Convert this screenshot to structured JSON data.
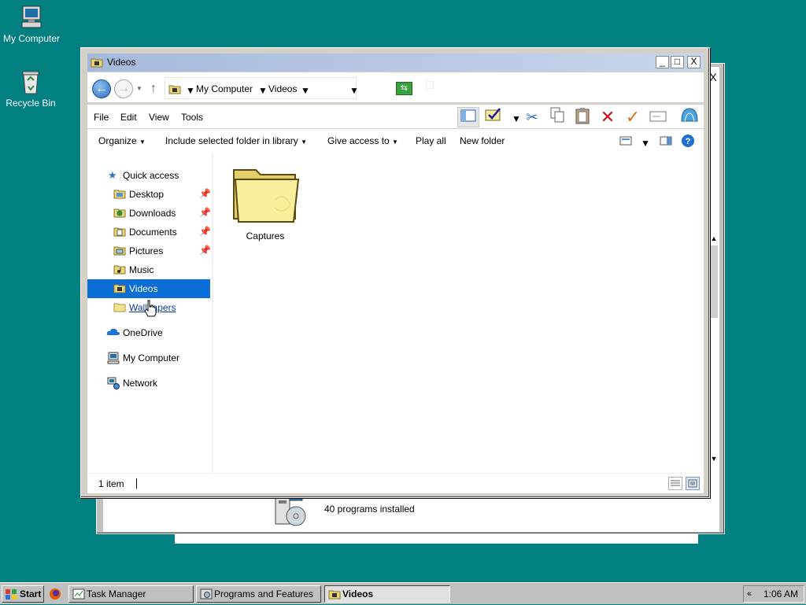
{
  "desktop": {
    "icons": [
      {
        "label": "My Computer"
      },
      {
        "label": "Recycle Bin"
      }
    ]
  },
  "background_window": {
    "title": "Programs and Features",
    "status_text": "40 programs installed",
    "close_glyph": "X"
  },
  "explorer": {
    "title": "Videos",
    "title_buttons": {
      "minimize": "_",
      "maximize": "□",
      "close": "X"
    },
    "breadcrumbs": [
      "My Computer",
      "Videos"
    ],
    "menu": [
      "File",
      "Edit",
      "View",
      "Tools"
    ],
    "toolbar_icons": [
      "layout-icon",
      "checkmark-select-icon",
      "cut-icon",
      "copy-icon",
      "paste-icon",
      "delete-icon",
      "apply-icon",
      "rename-icon",
      "internet-icon"
    ],
    "commands": [
      {
        "label": "Organize",
        "dropdown": true
      },
      {
        "label": "Include selected folder in library",
        "dropdown": true
      },
      {
        "label": "Give access to",
        "dropdown": true
      },
      {
        "label": "Play all",
        "dropdown": false
      },
      {
        "label": "New folder",
        "dropdown": false
      }
    ],
    "nav": {
      "quick_access": "Quick access",
      "items": [
        {
          "label": "Desktop",
          "pinned": true
        },
        {
          "label": "Downloads",
          "pinned": true
        },
        {
          "label": "Documents",
          "pinned": true
        },
        {
          "label": "Pictures",
          "pinned": true
        },
        {
          "label": "Music",
          "pinned": false
        },
        {
          "label": "Videos",
          "pinned": false,
          "selected": true
        },
        {
          "label": "Wallpapers",
          "pinned": false
        }
      ],
      "onedrive": "OneDrive",
      "my_computer": "My Computer",
      "network": "Network"
    },
    "content": {
      "folders": [
        {
          "label": "Captures"
        }
      ]
    },
    "status": {
      "item_count": "1 item"
    }
  },
  "taskbar": {
    "start": "Start",
    "tasks": [
      {
        "label": "Task Manager",
        "active": false
      },
      {
        "label": "Programs and Features",
        "active": false
      },
      {
        "label": "Videos",
        "active": true
      }
    ],
    "tray_chevron": "«",
    "clock": "1:06 AM"
  },
  "colors": {
    "desktop": "#008080",
    "selection": "#0a6ed6",
    "title_gradient": "#a6b9dc"
  }
}
